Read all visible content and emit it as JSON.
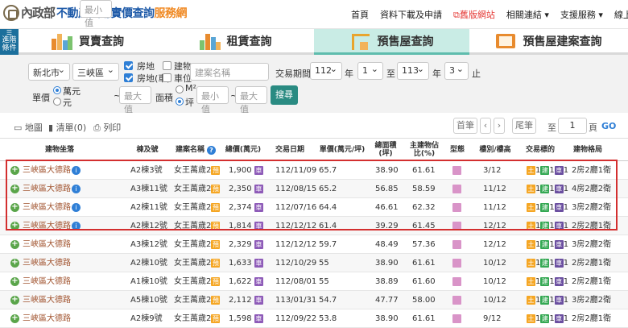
{
  "site": {
    "logo_text": "內政部",
    "title_main": "不動產交易實價查詢",
    "title_tail": "服務網"
  },
  "topnav": [
    "首頁",
    "資料下載及申請",
    "舊版網站",
    "相關連結",
    "支援服務",
    "線上數"
  ],
  "sidebar_btn": [
    "進階",
    "條件"
  ],
  "tabs": [
    "買賣查詢",
    "租賃查詢",
    "預售屋查詢",
    "預售屋建案查詢"
  ],
  "filter": {
    "city": "新北市",
    "district": "三峽區",
    "cb_house": "房地",
    "cb_building": "建物",
    "cb_house_car": "房地(車)",
    "cb_parking": "車位",
    "project_placeholder": "建案名稱",
    "period_label": "交易期間：",
    "year_from": "112",
    "year_unit": "年",
    "month_from": "1",
    "to": "至",
    "year_to": "113",
    "month_to": "3",
    "month_end": "止",
    "unit_price": "單價",
    "opt_wan": "萬元",
    "opt_yuan": "元",
    "min_price": "最小值",
    "max_price": "最大值",
    "sep": "~",
    "area": "面積",
    "opt_m2": "M²",
    "opt_ping": "坪",
    "min_area": "最小值",
    "max_area": "最大值",
    "search": "搜尋"
  },
  "toolbar": {
    "map": "地圖",
    "list": "清單(0)",
    "print": "列印",
    "first": "首筆",
    "last": "尾筆",
    "to": "至",
    "page": "1",
    "page_unit": "頁",
    "go": "GO"
  },
  "columns": [
    "建物坐落",
    "棟及號",
    "建案名稱",
    "總價(萬元)",
    "交易日期",
    "單價(萬元/坪)",
    "總面積(坪)",
    "主建物佔比(%)",
    "型態",
    "樓別/樓高",
    "交易標的",
    "建物格局"
  ],
  "rows": [
    {
      "addr": "三峽區大德路",
      "unit": "A2棟3號",
      "project": "女王萬歲2",
      "total": "1,900",
      "date": "112/11/09",
      "unit_price": "65.7",
      "area": "38.90",
      "ratio": "61.61",
      "floor": "3/12",
      "layout": "2房2廳1衛"
    },
    {
      "addr": "三峽區大德路",
      "unit": "A3棟11號",
      "project": "女王萬歲2",
      "total": "2,350",
      "date": "112/08/15",
      "unit_price": "65.2",
      "area": "56.85",
      "ratio": "58.59",
      "floor": "11/12",
      "layout": "4房2廳2衛"
    },
    {
      "addr": "三峽區大德路",
      "unit": "A2棟11號",
      "project": "女王萬歲2",
      "total": "2,374",
      "date": "112/07/16",
      "unit_price": "64.4",
      "area": "46.61",
      "ratio": "62.32",
      "floor": "11/12",
      "layout": "3房2廳2衛"
    },
    {
      "addr": "三峽區大德路",
      "unit": "A2棟12號",
      "project": "女王萬歲2",
      "total": "1,814",
      "date": "112/12/12",
      "unit_price": "61.4",
      "area": "39.29",
      "ratio": "61.45",
      "floor": "12/12",
      "layout": "2房2廳1衛"
    },
    {
      "addr": "三峽區大德路",
      "unit": "A3棟12號",
      "project": "女王萬歲2",
      "total": "2,329",
      "date": "112/12/12",
      "unit_price": "59.7",
      "area": "48.49",
      "ratio": "57.36",
      "floor": "12/12",
      "layout": "3房2廳2衛"
    },
    {
      "addr": "三峽區大德路",
      "unit": "A2棟10號",
      "project": "女王萬歲2",
      "total": "1,633",
      "date": "112/10/29",
      "unit_price": "55",
      "area": "38.90",
      "ratio": "61.61",
      "floor": "10/12",
      "layout": "2房2廳1衛"
    },
    {
      "addr": "三峽區大德路",
      "unit": "A1棟10號",
      "project": "女王萬歲2",
      "total": "1,622",
      "date": "112/08/01",
      "unit_price": "55",
      "area": "38.89",
      "ratio": "61.60",
      "floor": "10/12",
      "layout": "2房2廳1衛"
    },
    {
      "addr": "三峽區大德路",
      "unit": "A5棟10號",
      "project": "女王萬歲2",
      "total": "2,112",
      "date": "113/01/31",
      "unit_price": "54.7",
      "area": "47.77",
      "ratio": "58.00",
      "floor": "10/12",
      "layout": "3房2廳2衛"
    },
    {
      "addr": "三峽區大德路",
      "unit": "A2棟9號",
      "project": "女王萬歲2",
      "total": "1,598",
      "date": "112/09/22",
      "unit_price": "53.8",
      "area": "38.90",
      "ratio": "61.61",
      "floor": "9/12",
      "layout": "2房2廳1衛"
    }
  ],
  "tags": {
    "pre": "預",
    "car": "車",
    "type": "",
    "land": "土",
    "build": "建",
    "park": "車",
    "one": "1"
  }
}
